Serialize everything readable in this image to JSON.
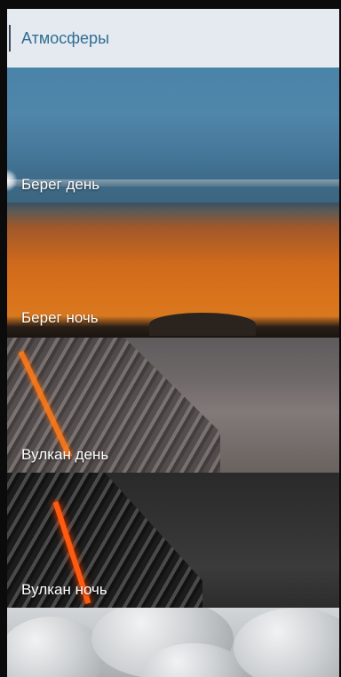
{
  "header": {
    "title": "Атмосферы"
  },
  "atmospheres": [
    {
      "label": "Берег день",
      "theme": "coast-day"
    },
    {
      "label": "Берег ночь",
      "theme": "coast-night"
    },
    {
      "label": "Вулкан день",
      "theme": "volcano-day"
    },
    {
      "label": "Вулкан ночь",
      "theme": "volcano-night"
    },
    {
      "label": "",
      "theme": "stones"
    }
  ],
  "colors": {
    "header_bg": "#e5eaf0",
    "header_title": "#2f6d93",
    "label_text": "#ffffff"
  }
}
